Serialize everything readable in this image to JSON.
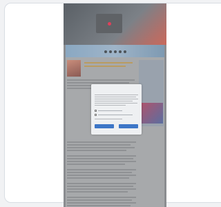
{
  "canvas_label": "",
  "theme": {
    "frame_background": "#f1f2f4",
    "card_background": "#ffffff",
    "phone_overlay": "#8b8d90",
    "dialog_background": "#eef0f2",
    "button_color": "#3d76c7",
    "record_indicator_color": "#e0405a"
  },
  "phone": {
    "video_icon": "record-dot-icon",
    "website": {
      "nav_icons": [
        "nav-dot-icon",
        "nav-dot-icon",
        "nav-dot-icon",
        "nav-dot-icon",
        "nav-dot-icon"
      ],
      "headline": "",
      "consent_dialog": {
        "title": "",
        "accept_label": "",
        "reject_label": ""
      }
    }
  }
}
